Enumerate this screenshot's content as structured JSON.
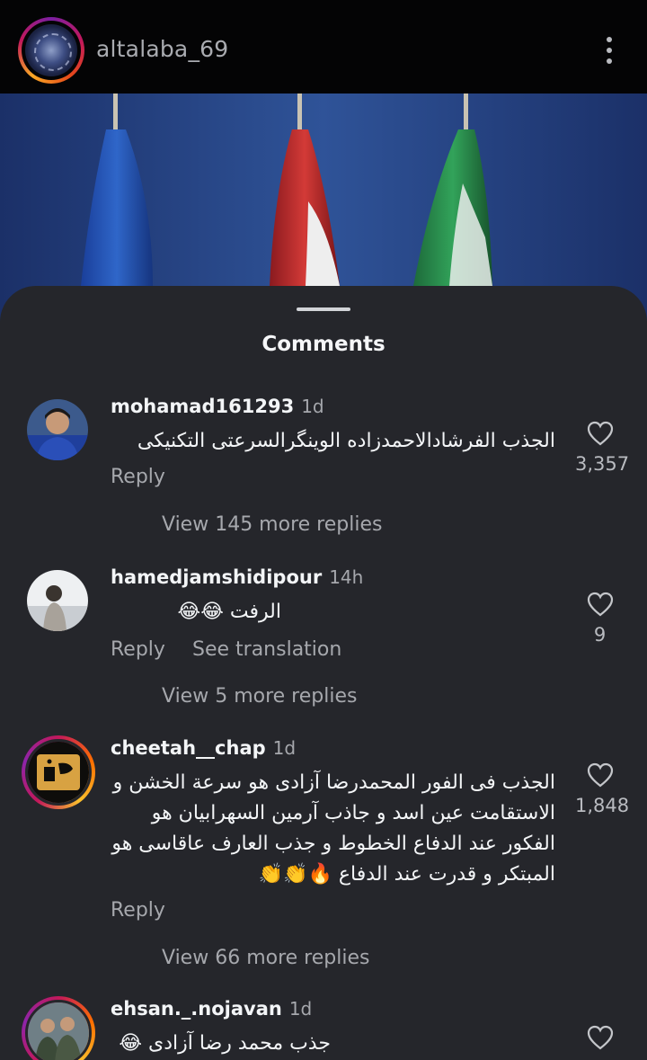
{
  "header": {
    "username": "altalaba_69"
  },
  "sheet": {
    "title": "Comments"
  },
  "comments": [
    {
      "username": "mohamad161293",
      "time": "1d",
      "text": "الجذب الفرشادالاحمدزاده الوينگرالسرعتی التکنیکی",
      "reply_label": "Reply",
      "likes": "3,357",
      "view_more": "View 145 more replies"
    },
    {
      "username": "hamedjamshidipour",
      "time": "14h",
      "text": "الرفت          😂😂",
      "reply_label": "Reply",
      "see_translation": "See translation",
      "likes": "9",
      "view_more": "View 5 more replies"
    },
    {
      "username": "cheetah__chap",
      "time": "1d",
      "text": "الجذب فی الفور المحمدرضا آزادی هو سرعة الخشن و الاستقامت عين اسد و جاذب آرمين السهرابيان هو الفکور عند الدفاع الخطوط و جذب العارف عاقاسی هو المبتکر و قدرت عند الدفاع 🔥👏👏",
      "reply_label": "Reply",
      "likes": "1,848",
      "view_more": "View 66 more replies"
    },
    {
      "username": "ehsan._.nojavan",
      "time": "1d",
      "text": "جذب محمد رضا آزادی 😂"
    }
  ],
  "icons": {
    "more": "more-vertical-icon",
    "like": "heart-outline-icon"
  },
  "colors": {
    "background": "#0b0b0d",
    "sheet": "#25262b",
    "primary_text": "#f3f5f7",
    "secondary_text": "#a6a8ad"
  }
}
